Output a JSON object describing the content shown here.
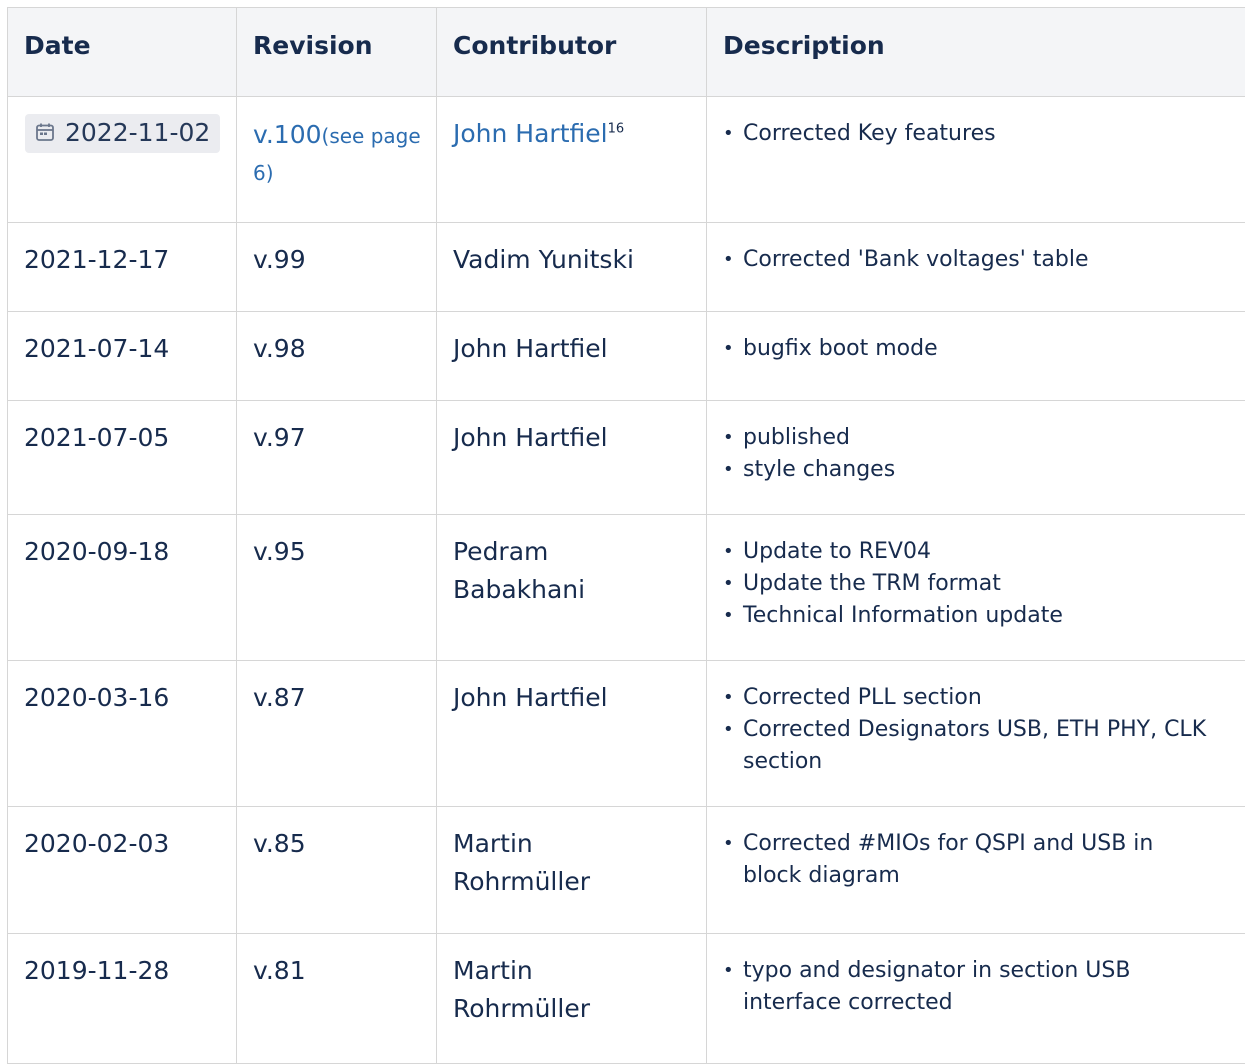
{
  "table": {
    "headers": {
      "date": "Date",
      "revision": "Revision",
      "contributor": "Contributor",
      "description": "Description"
    },
    "rows": [
      {
        "date": "2022-11-02",
        "revision": "v.100",
        "revision_ref": "(see page 6)",
        "contributor": "John Hartfiel",
        "contributor_footnote": "16",
        "description": [
          "Corrected Key features"
        ]
      },
      {
        "date": "2021-12-17",
        "revision": "v.99",
        "contributor": "Vadim Yunitski",
        "description": [
          "Corrected 'Bank voltages' table"
        ]
      },
      {
        "date": "2021-07-14",
        "revision": "v.98",
        "contributor": "John Hartfiel",
        "description": [
          "bugfix boot mode"
        ]
      },
      {
        "date": "2021-07-05",
        "revision": "v.97",
        "contributor": "John Hartfiel",
        "description": [
          "published",
          "style changes"
        ]
      },
      {
        "date": "2020-09-18",
        "revision": "v.95",
        "contributor": "Pedram Babakhani",
        "description": [
          "Update to REV04",
          "Update the TRM format",
          "Technical Information update"
        ]
      },
      {
        "date": "2020-03-16",
        "revision": "v.87",
        "contributor": "John Hartfiel",
        "description": [
          "Corrected PLL section",
          "Corrected Designators USB, ETH PHY, CLK section"
        ]
      },
      {
        "date": "2020-02-03",
        "revision": "v.85",
        "contributor": "Martin Rohrmüller",
        "description": [
          "Corrected #MIOs for QSPI and USB in block diagram"
        ]
      },
      {
        "date": "2019-11-28",
        "revision": "v.81",
        "contributor": "Martin Rohrmüller",
        "description": [
          "typo and designator in section USB interface corrected"
        ]
      }
    ]
  },
  "icons": {
    "date_chip": "calendar-icon"
  },
  "colors": {
    "header_bg": "#f4f5f7",
    "link": "#2b6cb0",
    "border": "#d6d6d6",
    "chip_bg": "#ebecf0"
  }
}
